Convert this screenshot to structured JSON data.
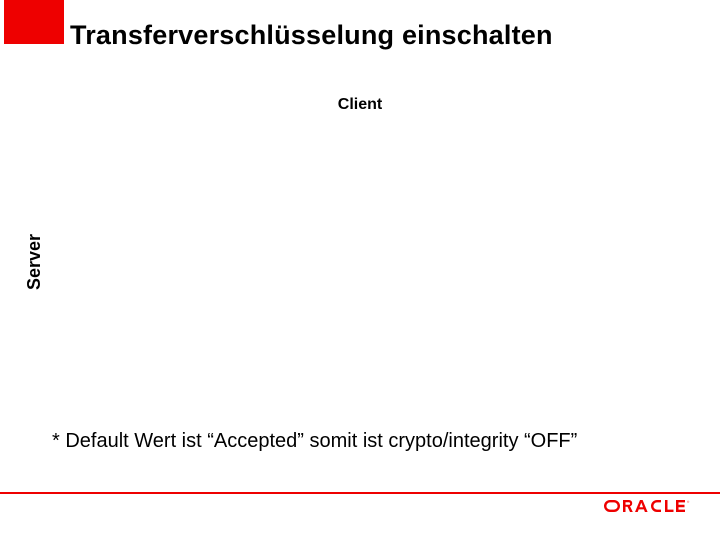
{
  "title": "Transferverschlüsselung einschalten",
  "labels": {
    "client": "Client",
    "server": "Server"
  },
  "footnote": "* Default Wert ist “Accepted” somit ist crypto/integrity “OFF”",
  "brand": {
    "logo_name": "ORACLE",
    "accent_color": "#ee0000"
  }
}
